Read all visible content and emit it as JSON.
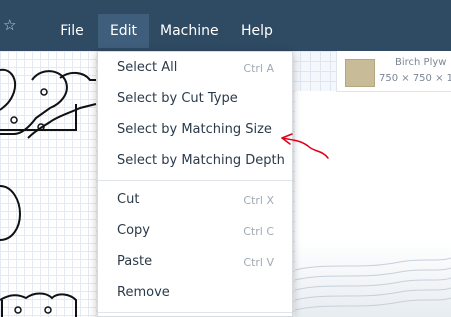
{
  "menubar": {
    "items": [
      {
        "label": "File"
      },
      {
        "label": "Edit"
      },
      {
        "label": "Machine"
      },
      {
        "label": "Help"
      }
    ],
    "active": "Edit"
  },
  "material": {
    "name": "Birch Plyw",
    "size": "750 × 750 × 1("
  },
  "edit_menu": {
    "items": [
      {
        "label": "Select All",
        "shortcut": "Ctrl A"
      },
      {
        "label": "Select by Cut Type",
        "shortcut": ""
      },
      {
        "label": "Select by Matching Size",
        "shortcut": ""
      },
      {
        "label": "Select by Matching Depth",
        "shortcut": ""
      },
      {
        "label": "Cut",
        "shortcut": "Ctrl X"
      },
      {
        "label": "Copy",
        "shortcut": "Ctrl C"
      },
      {
        "label": "Paste",
        "shortcut": "Ctrl V"
      },
      {
        "label": "Remove",
        "shortcut": ""
      }
    ]
  },
  "colors": {
    "menubar_bg": "#2f4a63",
    "menubar_active": "#3f5e7b",
    "annotation": "#e0001b"
  },
  "icons": [
    "star-icon"
  ]
}
